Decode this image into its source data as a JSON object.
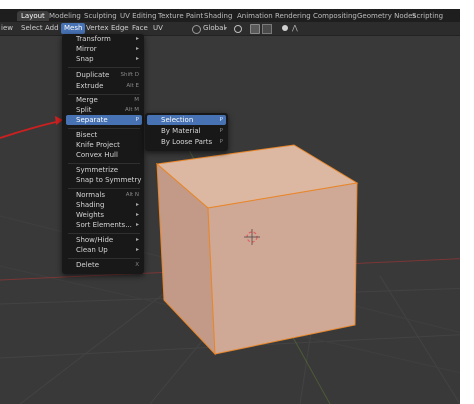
{
  "tabs": [
    {
      "label": "Layout",
      "active": true
    },
    {
      "label": "Modeling"
    },
    {
      "label": "Sculpting"
    },
    {
      "label": "UV Editing"
    },
    {
      "label": "Texture Paint"
    },
    {
      "label": "Shading"
    },
    {
      "label": "Animation"
    },
    {
      "label": "Rendering"
    },
    {
      "label": "Compositing"
    },
    {
      "label": "Geometry Nodes"
    },
    {
      "label": "Scripting"
    }
  ],
  "header": {
    "view": "iew",
    "select": "Select",
    "add": "Add",
    "mesh": "Mesh",
    "vertex": "Vertex",
    "edge": "Edge",
    "face": "Face",
    "uv": "UV",
    "orientation": "Global"
  },
  "mesh_menu": {
    "items": [
      {
        "label": "Transform",
        "shortcut": "",
        "submenu": true
      },
      {
        "label": "Mirror",
        "shortcut": "",
        "submenu": true
      },
      {
        "label": "Snap",
        "shortcut": "",
        "submenu": true
      },
      {
        "label": "Duplicate",
        "shortcut": "Shift D"
      },
      {
        "label": "Extrude",
        "shortcut": "Alt E",
        "submenu": true
      },
      {
        "label": "Merge",
        "shortcut": "M",
        "submenu": true
      },
      {
        "label": "Split",
        "shortcut": "Alt M",
        "submenu": true
      },
      {
        "label": "Separate",
        "shortcut": "P",
        "submenu": true,
        "highlighted": true
      },
      {
        "label": "Bisect"
      },
      {
        "label": "Knife Project"
      },
      {
        "label": "Convex Hull"
      },
      {
        "label": "Symmetrize"
      },
      {
        "label": "Snap to Symmetry"
      },
      {
        "label": "Normals",
        "shortcut": "Alt N",
        "submenu": true
      },
      {
        "label": "Shading",
        "submenu": true
      },
      {
        "label": "Weights",
        "submenu": true
      },
      {
        "label": "Sort Elements...",
        "submenu": true
      },
      {
        "label": "Show/Hide",
        "submenu": true
      },
      {
        "label": "Clean Up",
        "submenu": true
      },
      {
        "label": "Delete",
        "shortcut": "X",
        "submenu": true
      }
    ]
  },
  "separate_menu": {
    "items": [
      {
        "label": "Selection",
        "shortcut": "P",
        "highlighted": true
      },
      {
        "label": "By Material",
        "shortcut": "P"
      },
      {
        "label": "By Loose Parts",
        "shortcut": "P"
      }
    ]
  },
  "colors": {
    "accent": "#4772b3",
    "cube_top": "#dcb8a2",
    "cube_front": "#d0a996",
    "cube_left": "#c39a87",
    "cube_edge": "#e8862a",
    "annotation_arrow": "#cc2020"
  }
}
